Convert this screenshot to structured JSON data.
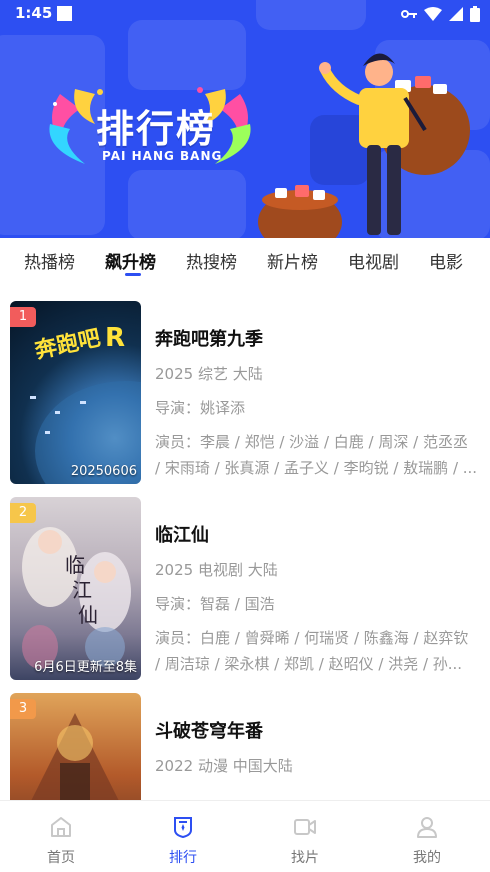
{
  "status": {
    "time": "1:45"
  },
  "header": {
    "title": "排行榜",
    "subtitle": "PAI HANG BANG"
  },
  "tabs": [
    "热播榜",
    "飙升榜",
    "热搜榜",
    "新片榜",
    "电视剧",
    "电影"
  ],
  "active_tab": 1,
  "list": [
    {
      "rank": "1",
      "title": "奔跑吧第九季",
      "meta": "2025 综艺 大陆",
      "director": "导演：姚译添",
      "actors_line1": "演员：李晨 / 郑恺 / 沙溢 / 白鹿 / 周深 / 范丞丞",
      "actors_line2": "/ 宋雨琦 / 张真源 / 孟子义 / 李昀锐 / 敖瑞鹏 / ...",
      "poster_note": "20250606"
    },
    {
      "rank": "2",
      "title": "临江仙",
      "meta": "2025 电视剧 大陆",
      "director": "导演：智磊 / 国浩",
      "actors_line1": "演员：白鹿 / 曾舜晞 / 何瑞贤 / 陈鑫海 / 赵弈钦",
      "actors_line2": "/ 周洁琼 / 梁永棋 / 郑凯 / 赵昭仪 / 洪尧 / 孙...",
      "poster_note": "6月6日更新至8集"
    },
    {
      "rank": "3",
      "title": "斗破苍穹年番",
      "meta": "2022 动漫 中国大陆",
      "director": "",
      "actors_line1": "",
      "actors_line2": "",
      "poster_note": ""
    }
  ],
  "nav": [
    {
      "label": "首页",
      "icon": "home-icon"
    },
    {
      "label": "排行",
      "icon": "rank-shield-icon"
    },
    {
      "label": "找片",
      "icon": "video-camera-icon"
    },
    {
      "label": "我的",
      "icon": "user-icon"
    }
  ],
  "colors": {
    "brand": "#2d4ff2",
    "rank1": "#f25c5c",
    "rank2": "#f6c64a",
    "rank3": "#f2994a"
  }
}
